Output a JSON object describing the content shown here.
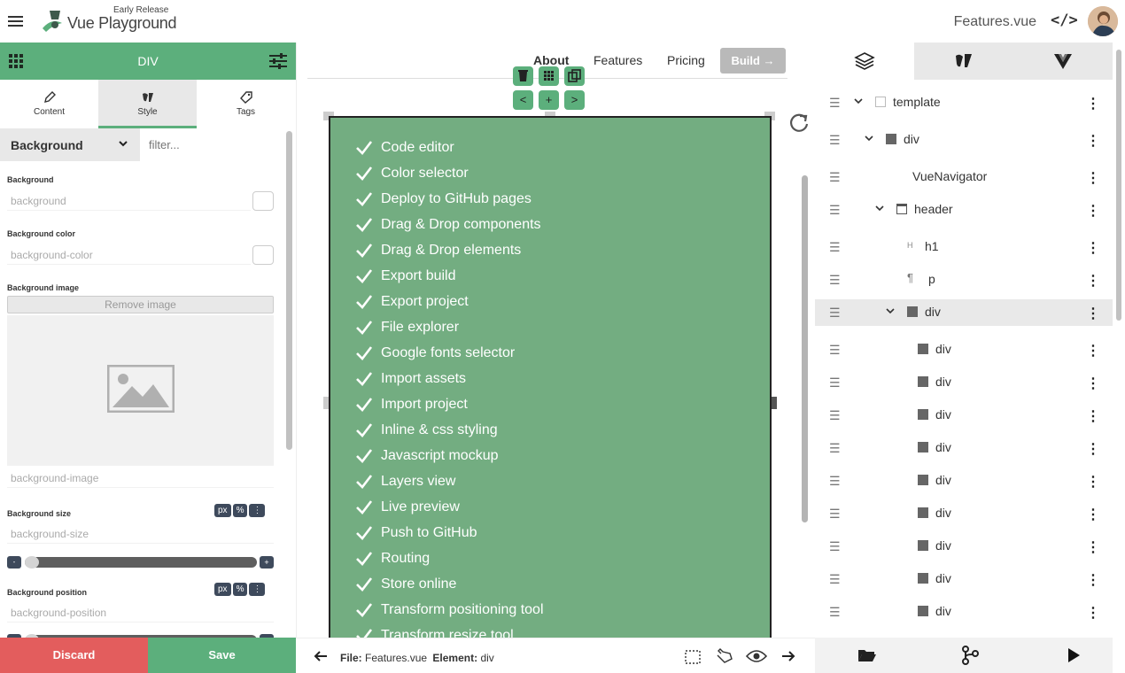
{
  "topbar": {
    "brand_sub": "Early Release",
    "brand": "Vue Playground",
    "filename": "Features.vue",
    "code_label": "</>"
  },
  "left_panel": {
    "title": "DIV",
    "tabs": [
      {
        "label": "Content",
        "icon": "pencil-icon"
      },
      {
        "label": "Style",
        "icon": "style-icon"
      },
      {
        "label": "Tags",
        "icon": "tag-icon"
      }
    ],
    "active_tab": "Style",
    "section": "Background",
    "filter_placeholder": "filter...",
    "props": {
      "bg_label": "Background",
      "bg_placeholder": "background",
      "bgcolor_label": "Background color",
      "bgcolor_placeholder": "background-color",
      "bgimage_label": "Background image",
      "remove_image": "Remove image",
      "bgimage_placeholder": "background-image",
      "bgsize_label": "Background size",
      "bgsize_placeholder": "background-size",
      "bgpos_label": "Background position",
      "bgpos_placeholder": "background-position",
      "units": [
        "px",
        "%",
        "⋮"
      ],
      "slider_min": "-",
      "slider_plus": "+"
    },
    "discard": "Discard",
    "save": "Save"
  },
  "canvas": {
    "nav": [
      "About",
      "Features",
      "Pricing"
    ],
    "build": "Build →",
    "tools": {
      "plus": "+",
      "left": "<",
      "right": ">"
    },
    "features": [
      "Code editor",
      "Color selector",
      "Deploy to GitHub pages",
      "Drag & Drop components",
      "Drag & Drop elements",
      "Export build",
      "Export project",
      "File explorer",
      "Google fonts selector",
      "Import assets",
      "Import project",
      "Inline & css styling",
      "Javascript mockup",
      "Layers view",
      "Live preview",
      "Push to GitHub",
      "Routing",
      "Store online",
      "Transform positioning tool",
      "Transform resize tool"
    ],
    "box_color": "#73ad81"
  },
  "statusbar": {
    "file_label": "File:",
    "file_value": "Features.vue",
    "element_label": "Element:",
    "element_value": "div"
  },
  "tree": {
    "rows": [
      {
        "label": "template",
        "icon": "square-outline-icon",
        "expandable": true
      },
      {
        "label": "div",
        "icon": "square-icon",
        "expandable": true
      },
      {
        "label": "VueNavigator",
        "icon": "",
        "expandable": false
      },
      {
        "label": "header",
        "icon": "window-icon",
        "expandable": true
      },
      {
        "label": "h1",
        "icon": "heading-icon",
        "expandable": false
      },
      {
        "label": "p",
        "icon": "paragraph-icon",
        "expandable": false
      },
      {
        "label": "div",
        "icon": "square-icon",
        "expandable": true,
        "selected": true
      },
      {
        "label": "div",
        "icon": "square-icon"
      },
      {
        "label": "div",
        "icon": "square-icon"
      },
      {
        "label": "div",
        "icon": "square-icon"
      },
      {
        "label": "div",
        "icon": "square-icon"
      },
      {
        "label": "div",
        "icon": "square-icon"
      },
      {
        "label": "div",
        "icon": "square-icon"
      },
      {
        "label": "div",
        "icon": "square-icon"
      },
      {
        "label": "div",
        "icon": "square-icon"
      },
      {
        "label": "div",
        "icon": "square-icon"
      }
    ],
    "h1_icon_text": "H",
    "p_icon_text": "¶"
  },
  "colors": {
    "accent": "#5caf7c",
    "danger": "#e35d5d",
    "unit_bg": "#3e4a5c"
  }
}
